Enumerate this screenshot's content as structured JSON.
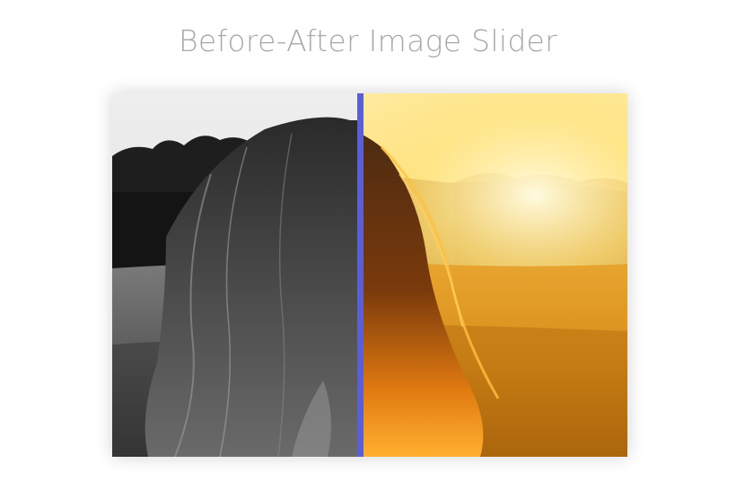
{
  "header": {
    "title": "Before-After Image Slider"
  },
  "slider": {
    "position_percent": 48,
    "accent_color": "#5a5fd8",
    "before_label": "grayscale",
    "after_label": "color"
  }
}
